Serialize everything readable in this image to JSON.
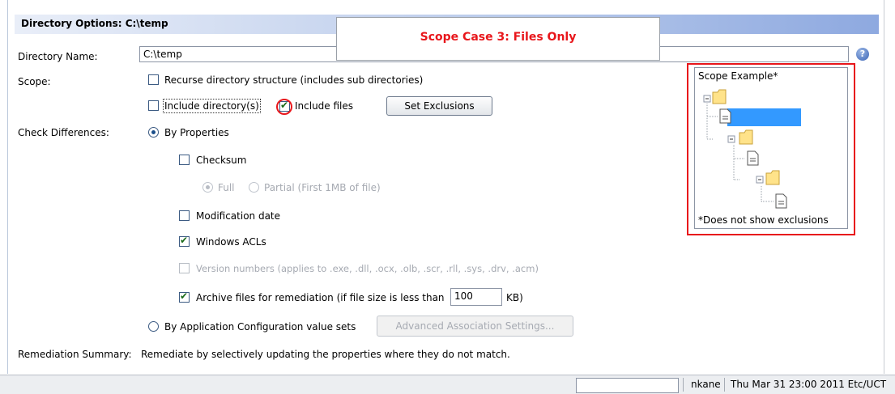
{
  "header": {
    "title": "Directory Options: C:\\temp"
  },
  "callout": {
    "text": "Scope Case 3: Files Only"
  },
  "labels": {
    "directory_name": "Directory Name:",
    "scope": "Scope:",
    "check_differences": "Check Differences:",
    "remediation_summary": "Remediation Summary:"
  },
  "directory_name": {
    "value": "C:\\temp"
  },
  "scope": {
    "recurse": {
      "label": "Recurse directory structure (includes sub directories)",
      "checked": false
    },
    "include_dirs": {
      "label": "Include directory(s)",
      "checked": false
    },
    "include_files": {
      "label": "Include files",
      "checked": true
    },
    "set_exclusions": "Set Exclusions"
  },
  "check": {
    "by_properties": {
      "label": "By Properties",
      "selected": true
    },
    "checksum": {
      "label": "Checksum",
      "checked": false
    },
    "full": {
      "label": "Full",
      "selected": true,
      "disabled": true
    },
    "partial": {
      "label": "Partial (First 1MB of file)",
      "selected": false,
      "disabled": true
    },
    "modification_date": {
      "label": "Modification date",
      "checked": false
    },
    "windows_acls": {
      "label": "Windows ACLs",
      "checked": true
    },
    "version_numbers": {
      "label": "Version numbers (applies to .exe, .dll, .ocx, .olb, .scr, .rll, .sys, .drv, .acm)",
      "checked": false,
      "disabled": true
    },
    "archive": {
      "label": "Archive files for remediation (if file size is less than",
      "checked": true,
      "size": "100",
      "unit": "KB)"
    },
    "by_app_config": {
      "label": "By Application Configuration value sets",
      "selected": false
    },
    "advanced_button": "Advanced Association Settings..."
  },
  "remediation": {
    "text": "Remediate by selectively updating the properties where they do not match."
  },
  "scope_example": {
    "title": "Scope Example*",
    "note": "*Does not show exclusions"
  },
  "status": {
    "user": "nkane",
    "datetime": "Thu Mar 31 23:00 2011 Etc/UCT"
  },
  "icons": {
    "help": "help-icon",
    "folder": "folder-icon",
    "file": "file-icon"
  },
  "colors": {
    "accent_red": "#e8161b",
    "header_blue": "#8ea9e0"
  }
}
